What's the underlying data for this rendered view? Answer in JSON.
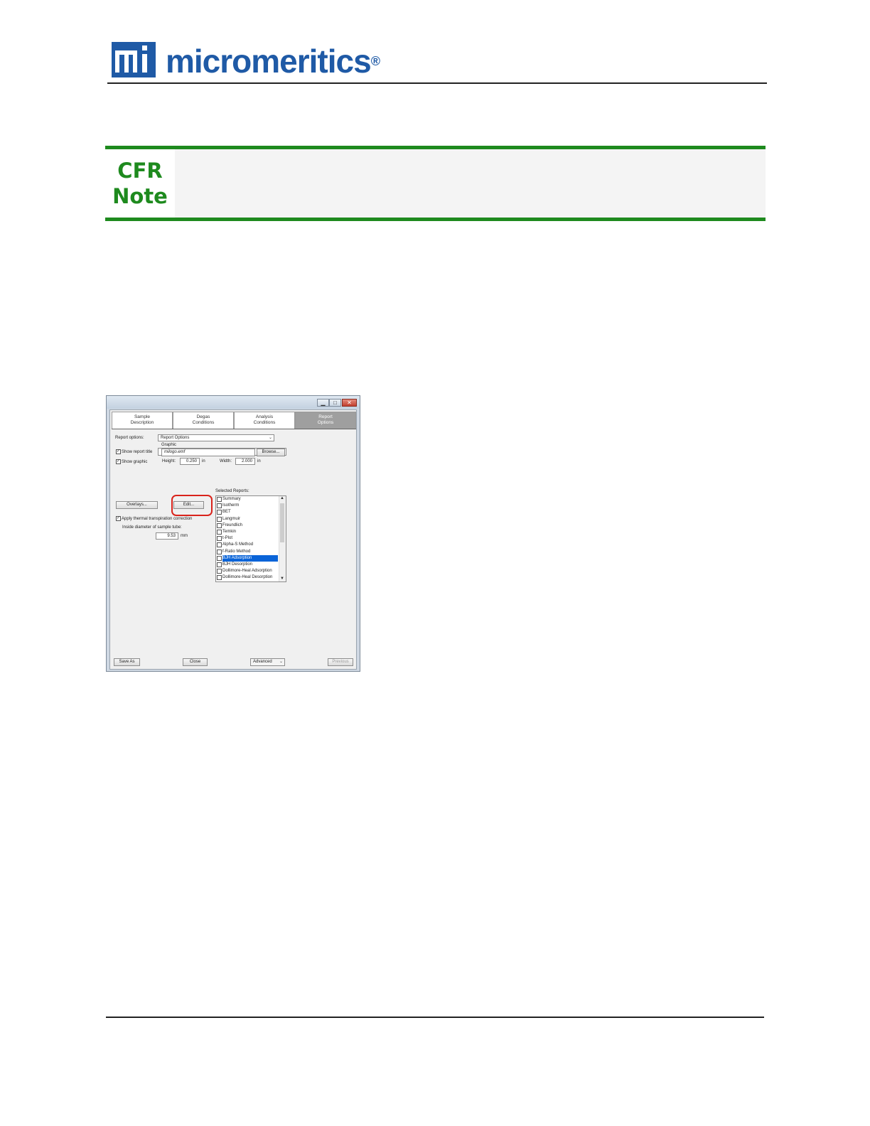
{
  "header": {
    "logo_mark": "mi",
    "logo_text": "micromeritics",
    "logo_reg": "®",
    "brand_color": "#1f5aa6"
  },
  "cfr_note": {
    "line1": "CFR",
    "line2": "Note",
    "accent_color": "#1e8a1e"
  },
  "dialog": {
    "window_buttons": {
      "minimize": "▁",
      "maximize": "□",
      "close": "✕"
    },
    "tabs": [
      {
        "label": "Sample\nDescription",
        "active": false
      },
      {
        "label": "Degas\nConditions",
        "active": false
      },
      {
        "label": "Analysis\nConditions",
        "active": false
      },
      {
        "label": "Report\nOptions",
        "active": true
      }
    ],
    "report_options_label": "Report options:",
    "report_options_value": "Report Options",
    "show_report_title_label": "Show report title",
    "show_report_title_checked": "✓",
    "report_title_value": "",
    "show_graphic_label": "Show graphic",
    "show_graphic_checked": "✓",
    "graphic_label": "Graphic",
    "graphic_value": "milogo.emf",
    "browse_label": "Browse...",
    "height_label": "Height:",
    "height_value": "0.250",
    "height_unit": "in",
    "width_label": "Width:",
    "width_value": "2.000",
    "width_unit": "in",
    "overlays_label": "Overlays...",
    "edit_label": "Edit...",
    "selected_reports_label": "Selected Reports:",
    "selected_reports": [
      {
        "label": "Summary",
        "selected": false
      },
      {
        "label": "Isotherm",
        "selected": false
      },
      {
        "label": "BET",
        "selected": false
      },
      {
        "label": "Langmuir",
        "selected": false
      },
      {
        "label": "Freundlich",
        "selected": false
      },
      {
        "label": "Temkin",
        "selected": false
      },
      {
        "label": "t-Plot",
        "selected": false
      },
      {
        "label": "Alpha-S Method",
        "selected": false
      },
      {
        "label": "f-Ratio Method",
        "selected": false
      },
      {
        "label": "BJH Adsorption",
        "selected": true
      },
      {
        "label": "BJH Desorption",
        "selected": false
      },
      {
        "label": "Dollimore-Heal Adsorption",
        "selected": false
      },
      {
        "label": "Dollimore-Heal Desorption",
        "selected": false
      }
    ],
    "thermal_label": "Apply thermal transpiration correction",
    "thermal_checked": "✓",
    "inside_diameter_label": "Inside diameter of sample tube:",
    "inside_diameter_value": "9.53",
    "inside_diameter_unit": "mm",
    "save_as_label": "Save As",
    "close_label": "Close",
    "advanced_label": "Advanced",
    "previous_label": "Previous"
  }
}
